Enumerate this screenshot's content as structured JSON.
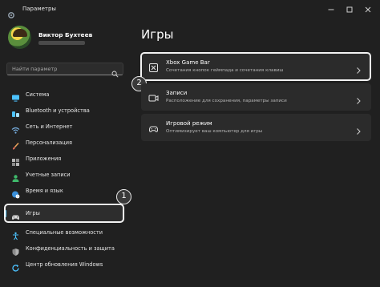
{
  "window": {
    "title": "Параметры",
    "controls": [
      "minimize-icon",
      "maximize-icon",
      "close-icon"
    ]
  },
  "user": {
    "name": "Виктор Бухтеев"
  },
  "search": {
    "placeholder": "Найти параметр"
  },
  "sidebar": {
    "items": [
      {
        "label": "Система",
        "icon": "monitor-icon"
      },
      {
        "label": "Bluetooth и устройства",
        "icon": "bluetooth-icon"
      },
      {
        "label": "Сеть и Интернет",
        "icon": "wifi-icon"
      },
      {
        "label": "Персонализация",
        "icon": "brush-icon"
      },
      {
        "label": "Приложения",
        "icon": "apps-icon"
      },
      {
        "label": "Учетные записи",
        "icon": "person-icon"
      },
      {
        "label": "Время и язык",
        "icon": "globe-clock-icon"
      },
      {
        "label": "Игры",
        "icon": "gamepad-icon",
        "active": true
      },
      {
        "label": "Специальные возможности",
        "icon": "accessibility-icon"
      },
      {
        "label": "Конфиденциальность и защита",
        "icon": "shield-icon"
      },
      {
        "label": "Центр обновления Windows",
        "icon": "update-icon"
      }
    ]
  },
  "main": {
    "title": "Игры",
    "cards": [
      {
        "title": "Xbox Game Bar",
        "subtitle": "Сочетания кнопок геймпада и сочетания клавиш",
        "icon": "xbox-game-bar-icon"
      },
      {
        "title": "Записи",
        "subtitle": "Расположение для сохранения, параметры записи",
        "icon": "capture-icon"
      },
      {
        "title": "Игровой режим",
        "subtitle": "Оптимизирует ваш компьютер для игры",
        "icon": "game-mode-icon"
      }
    ]
  },
  "annotations": {
    "step1": "1",
    "step2": "2"
  },
  "colors": {
    "background": "#202020",
    "card": "#2b2b2b",
    "accent": "#60cdff"
  }
}
